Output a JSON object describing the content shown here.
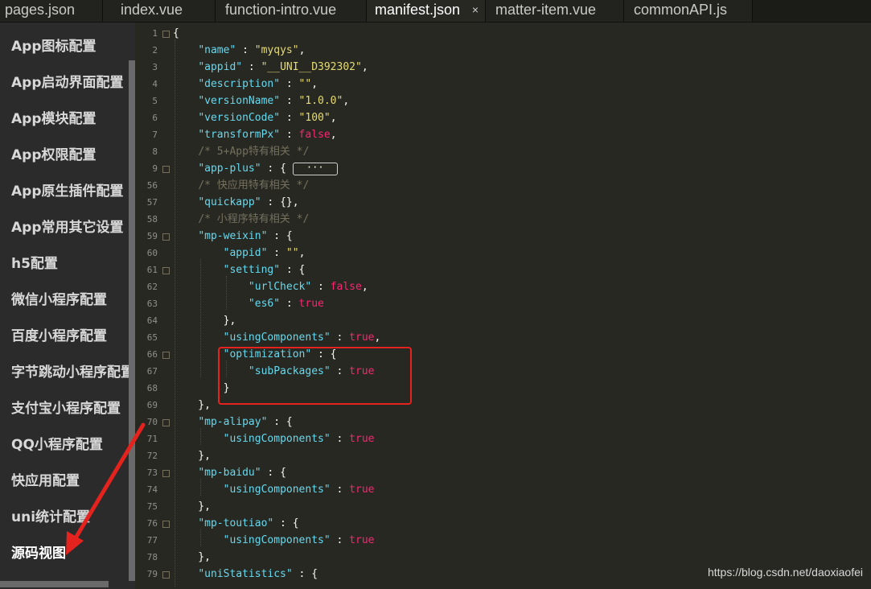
{
  "tabs": [
    {
      "label": "pages.json"
    },
    {
      "label": "index.vue"
    },
    {
      "label": "function-intro.vue"
    },
    {
      "label": "manifest.json",
      "close": "×"
    },
    {
      "label": "matter-item.vue"
    },
    {
      "label": "commonAPI.js"
    }
  ],
  "sidebar": {
    "items": [
      {
        "label": "App图标配置"
      },
      {
        "label": "App启动界面配置"
      },
      {
        "label": "App模块配置"
      },
      {
        "label": "App权限配置"
      },
      {
        "label": "App原生插件配置"
      },
      {
        "label": "App常用其它设置"
      },
      {
        "label": "h5配置"
      },
      {
        "label": "微信小程序配置"
      },
      {
        "label": "百度小程序配置"
      },
      {
        "label": "字节跳动小程序配置"
      },
      {
        "label": "支付宝小程序配置"
      },
      {
        "label": "QQ小程序配置"
      },
      {
        "label": "快应用配置"
      },
      {
        "label": "uni统计配置"
      },
      {
        "label": "源码视图"
      }
    ]
  },
  "editor": {
    "line_numbers": [
      "1",
      "2",
      "3",
      "4",
      "5",
      "6",
      "7",
      "8",
      "9",
      "56",
      "57",
      "58",
      "59",
      "60",
      "61",
      "62",
      "63",
      "64",
      "65",
      "66",
      "67",
      "68",
      "69",
      "70",
      "71",
      "72",
      "73",
      "74",
      "75",
      "76",
      "77",
      "78",
      "79"
    ],
    "lines": {
      "l1": "{",
      "l2k": "\"name\"",
      "l2v": "\"myqys\"",
      "l3k": "\"appid\"",
      "l3v": "\"__UNI__D392302\"",
      "l4k": "\"description\"",
      "l4v": "\"\"",
      "l5k": "\"versionName\"",
      "l5v": "\"1.0.0\"",
      "l6k": "\"versionCode\"",
      "l6v": "\"100\"",
      "l7k": "\"transformPx\"",
      "l7v": "false",
      "l8c": "/* 5+App特有相关 */",
      "l9k": "\"app-plus\"",
      "l9e": "···",
      "l56c": "/* 快应用特有相关 */",
      "l57k": "\"quickapp\"",
      "l58c": "/* 小程序特有相关 */",
      "l59k": "\"mp-weixin\"",
      "l60k": "\"appid\"",
      "l60v": "\"\"",
      "l61k": "\"setting\"",
      "l62k": "\"urlCheck\"",
      "l62v": "false",
      "l63k": "\"es6\"",
      "l63v": "true",
      "l65k": "\"usingComponents\"",
      "l65v": "true",
      "l66k": "\"optimization\"",
      "l67k": "\"subPackages\"",
      "l67v": "true",
      "l70k": "\"mp-alipay\"",
      "l71k": "\"usingComponents\"",
      "l71v": "true",
      "l73k": "\"mp-baidu\"",
      "l74k": "\"usingComponents\"",
      "l74v": "true",
      "l76k": "\"mp-toutiao\"",
      "l77k": "\"usingComponents\"",
      "l77v": "true",
      "l79k": "\"uniStatistics\""
    }
  },
  "watermark": "https://blog.csdn.net/daoxiaofei",
  "colors": {
    "highlight_box": "#e5231e",
    "arrow": "#e5231e",
    "key": "#66d9ef",
    "string": "#e6db74",
    "boolean": "#f92672",
    "comment": "#75715e"
  }
}
